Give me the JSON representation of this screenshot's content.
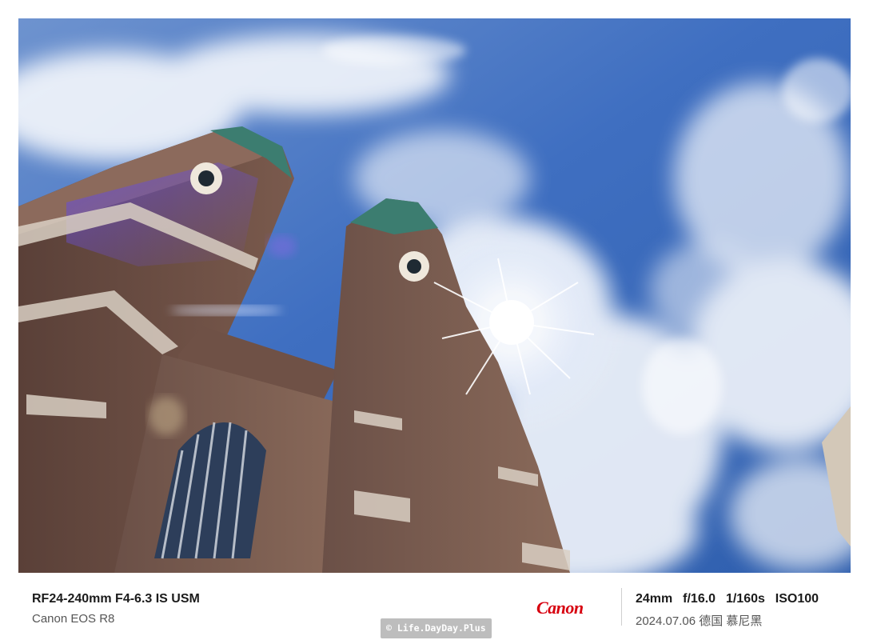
{
  "photo": {
    "subject": "photo-frauenkirche-towers"
  },
  "exif": {
    "lens": "RF24-240mm F4-6.3 IS USM",
    "camera": "Canon EOS R8",
    "brand": "Canon",
    "exposure": "24mm  f/16.0  1/160s  ISO100",
    "date_location": "2024.07.06 德国 慕尼黑"
  },
  "watermark": {
    "text": "© Life.DayDay.Plus"
  },
  "colors": {
    "brand_red": "#d7000f",
    "sky_blue": "#3f6fbf",
    "brick": "#7a5a4d",
    "copper_green": "#4b8a78"
  }
}
